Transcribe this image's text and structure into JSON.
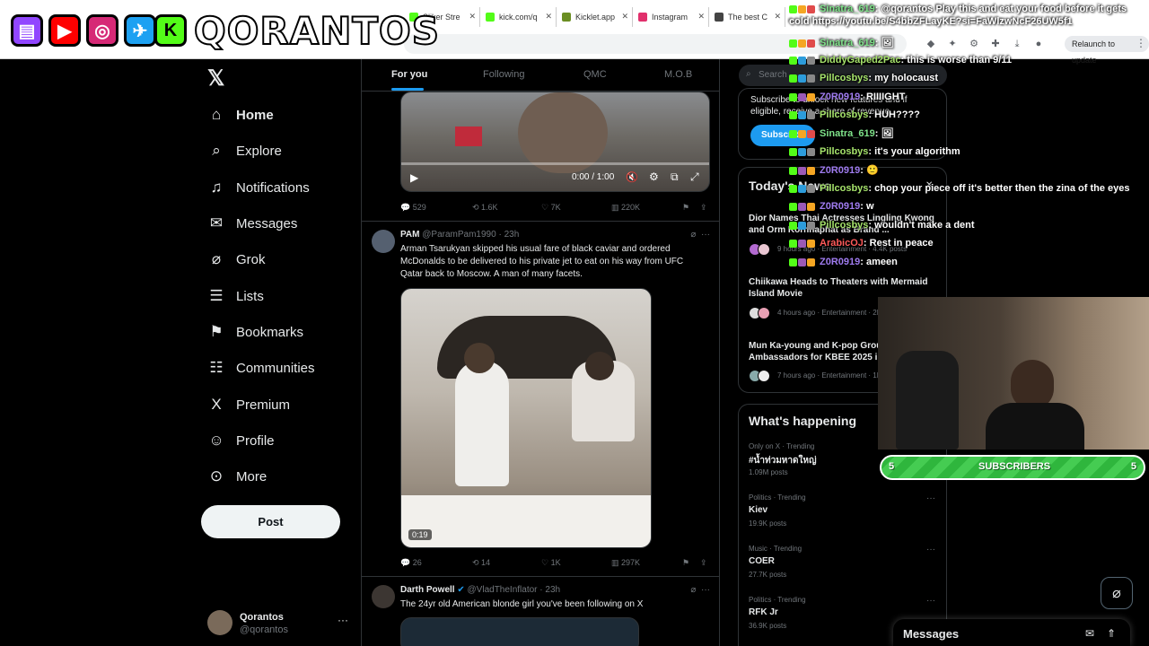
{
  "browser": {
    "tabs": [
      {
        "label": "Sliker Stre",
        "color": "#53fc18"
      },
      {
        "label": "kick.com/q",
        "color": "#53fc18"
      },
      {
        "label": "Kicklet.app",
        "color": "#6b8e23"
      },
      {
        "label": "Instagram",
        "color": "#e1306c"
      },
      {
        "label": "The best C",
        "color": "#444444"
      }
    ],
    "relaunch_label": "Relaunch to update"
  },
  "banner": {
    "channel_name": "QORANTOS",
    "icons": [
      "twitch-icon",
      "youtube-icon",
      "instagram-icon",
      "twitter-icon",
      "kick-icon"
    ]
  },
  "nav": {
    "items": [
      {
        "label": "Home",
        "icon": "⌂",
        "name": "home"
      },
      {
        "label": "Explore",
        "icon": "⌕",
        "name": "explore"
      },
      {
        "label": "Notifications",
        "icon": "♫",
        "name": "notifications"
      },
      {
        "label": "Messages",
        "icon": "✉",
        "name": "messages"
      },
      {
        "label": "Grok",
        "icon": "⌀",
        "name": "grok"
      },
      {
        "label": "Lists",
        "icon": "☰",
        "name": "lists"
      },
      {
        "label": "Bookmarks",
        "icon": "⚑",
        "name": "bookmarks"
      },
      {
        "label": "Communities",
        "icon": "☷",
        "name": "communities"
      },
      {
        "label": "Premium",
        "icon": "X",
        "name": "premium"
      },
      {
        "label": "Profile",
        "icon": "☺",
        "name": "profile"
      },
      {
        "label": "More",
        "icon": "⊙",
        "name": "more"
      }
    ],
    "post_label": "Post",
    "profile_name": "Qorantos",
    "profile_handle": "@qorantos",
    "more_dots": "···"
  },
  "timeline": {
    "tabs": [
      "For you",
      "Following",
      "QMC",
      "M.O.B"
    ],
    "video1": {
      "time": "0:00 / 1:00"
    },
    "actions1": {
      "replies": "529",
      "reposts": "1.6K",
      "likes": "7K",
      "views": "220K"
    },
    "tweet2": {
      "name": "PAM",
      "handle": "@ParamPam1990 · 23h",
      "text": "Arman Tsarukyan skipped his usual fare of black caviar and ordered McDonalds to be delivered to his private jet to eat on his way from UFC Qatar back to Moscow. A man of many facets.",
      "duration": "0:19",
      "replies": "26",
      "reposts": "14",
      "likes": "1K",
      "views": "297K"
    },
    "tweet3": {
      "name": "Darth Powell",
      "handle": "@VladTheInflator · 23h",
      "text": "The 24yr old American blonde girl you've been following on X"
    }
  },
  "right": {
    "search_placeholder": "Search",
    "subscribe": {
      "text": "Subscribe to unlock new features and if eligible, receive a share of revenue.",
      "button": "Subscribe"
    },
    "news_title": "Today's News",
    "news": [
      {
        "title": "Dior Names Thai Actresses Lingling Kwong and Orm Kornnaphat as Brand ...",
        "meta": "9 hours ago · Entertainment · 4.4K posts"
      },
      {
        "title": "Chiikawa Heads to Theaters with Mermaid Island Movie",
        "meta": "4 hours ago · Entertainment · 2K posts"
      },
      {
        "title": "Mun Ka-young and K-pop Group Ambassadors for KBEE 2025 in ...",
        "meta": "7 hours ago · Entertainment · 1K posts"
      }
    ],
    "happening_title": "What's happening",
    "trends": [
      {
        "meta": "Only on X · Trending",
        "name": "#น้ำท่วมหาดใหญ่",
        "count": "1.09M posts"
      },
      {
        "meta": "Politics · Trending",
        "name": "Kiev",
        "count": "19.9K posts"
      },
      {
        "meta": "Music · Trending",
        "name": "COER",
        "count": "27.7K posts"
      },
      {
        "meta": "Politics · Trending",
        "name": "RFK Jr",
        "count": "36.9K posts"
      }
    ]
  },
  "chat": [
    {
      "user": "Sinatra_619",
      "color": "#7fe38a",
      "msg": ": @qorantos Play this and eat your food before it gets cold https://youtu.be/S4bbZFLayKE?si=FaWlzwNcF26UW5f1"
    },
    {
      "user": "Sinatra_619",
      "color": "#7fe38a",
      "msg": ": 🖼"
    },
    {
      "user": "DiddyGaped2Pac",
      "color": "#a6e36b",
      "msg": ": this is worse than 9/11"
    },
    {
      "user": "Pillcosbys",
      "color": "#a6e36b",
      "msg": ": my holocaust"
    },
    {
      "user": "Z0R0919",
      "color": "#a07cf0",
      "msg": ": RIIIIGHT"
    },
    {
      "user": "Pillcosbys",
      "color": "#a6e36b",
      "msg": ": HUH????"
    },
    {
      "user": "Sinatra_619",
      "color": "#7fe38a",
      "msg": ": 🖼"
    },
    {
      "user": "Pillcosbys",
      "color": "#a6e36b",
      "msg": ": it's your algorithm"
    },
    {
      "user": "Z0R0919",
      "color": "#a07cf0",
      "msg": ": 🙂"
    },
    {
      "user": "Pillcosbys",
      "color": "#a6e36b",
      "msg": ": chop your piece off it's better then the zina of the eyes"
    },
    {
      "user": "Z0R0919",
      "color": "#a07cf0",
      "msg": ": w"
    },
    {
      "user": "Pillcosbys",
      "color": "#a6e36b",
      "msg": ": wouldn't make a dent"
    },
    {
      "user": "ArabicOJ",
      "color": "#ff5a5a",
      "msg": ": Rest in peace"
    },
    {
      "user": "Z0R0919",
      "color": "#a07cf0",
      "msg": ": ameen"
    }
  ],
  "subscribers": {
    "left": "5",
    "label": "SUBSCRIBERS",
    "right": "5"
  },
  "messages_dock": {
    "title": "Messages"
  }
}
